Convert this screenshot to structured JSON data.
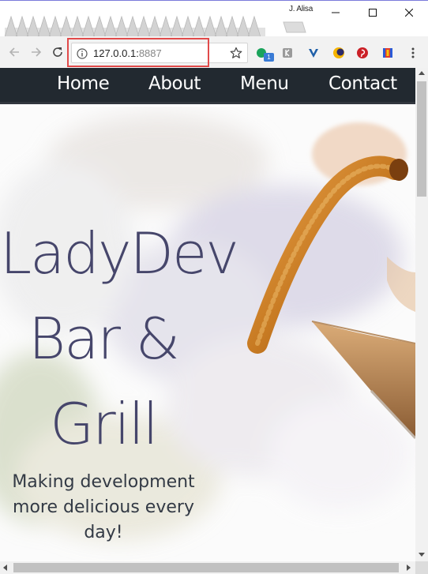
{
  "browser": {
    "profile_name": "J. Alisa",
    "url_host": "127.0.0.1:",
    "url_port": "8887",
    "extension_badge": "1"
  },
  "site": {
    "nav": {
      "home": "Home",
      "about": "About",
      "menu": "Menu",
      "contact": "Contact"
    },
    "hero": {
      "title_line1": "LadyDev",
      "title_line2": "Bar &",
      "title_line3": "Grill",
      "tagline": "Making development more delicious every day!"
    }
  },
  "colors": {
    "nav_bg": "#222930",
    "title_color": "#46466b",
    "highlight_box": "#e14a4a"
  },
  "icons": {
    "back": "arrow-left",
    "forward": "arrow-right",
    "reload": "reload",
    "info": "info-circle",
    "bookmark": "star",
    "menu": "kebab"
  }
}
